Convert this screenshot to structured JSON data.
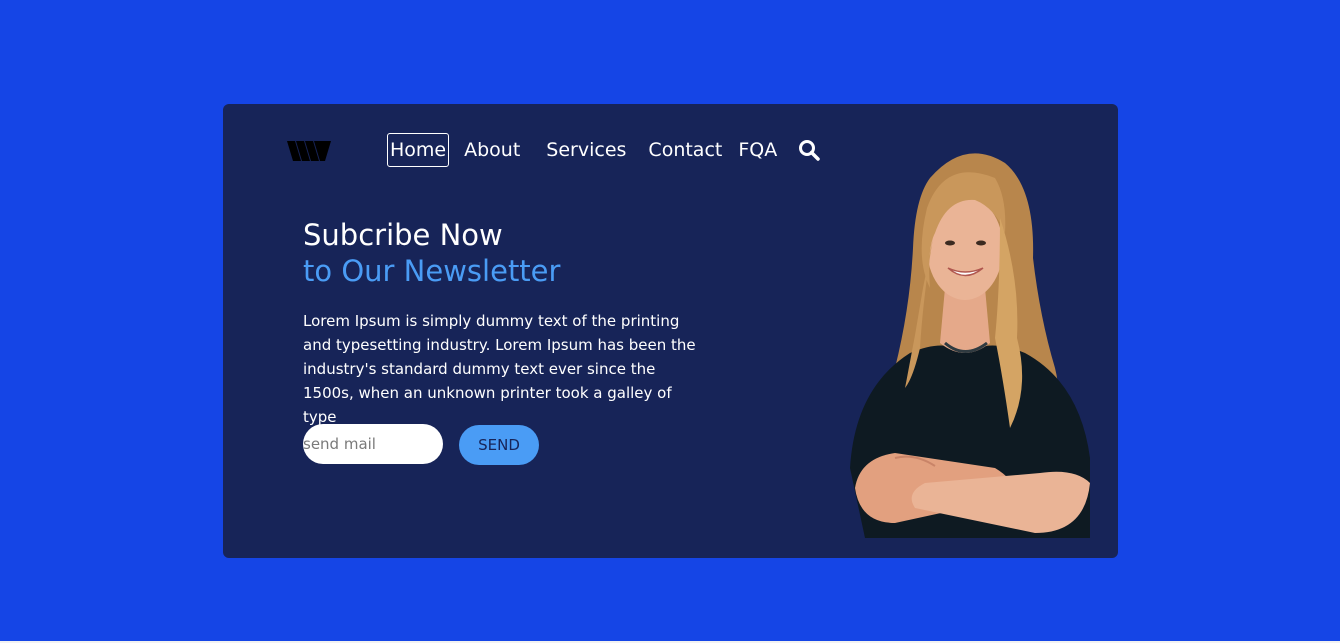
{
  "nav": {
    "items": [
      {
        "label": "Home",
        "active": true
      },
      {
        "label": "About"
      },
      {
        "label": "Services"
      },
      {
        "label": "Contact"
      },
      {
        "label": "FQA"
      }
    ],
    "search_icon": "search-icon"
  },
  "hero": {
    "title_line1": "Subcribe Now",
    "title_line2": "to Our Newsletter",
    "body": "Lorem Ipsum is simply dummy text of the printing and typesetting industry. Lorem Ipsum has been the industry's standard dummy text ever since the 1500s, when an unknown printer took a galley of type"
  },
  "subscribe": {
    "placeholder": "send mail",
    "button_label": "SEND"
  },
  "colors": {
    "page_background": "#1545e6",
    "card_background": "#172458",
    "accent": "#4a9cf5",
    "text": "#ffffff"
  }
}
